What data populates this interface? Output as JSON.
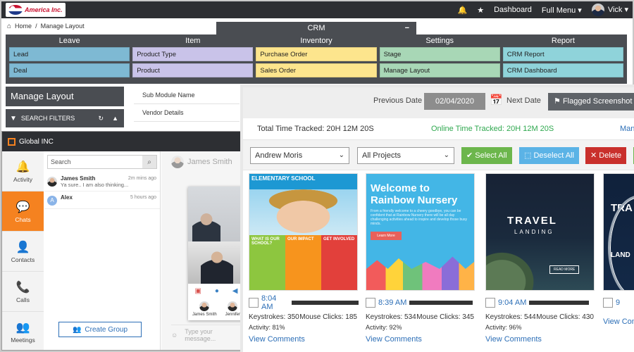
{
  "crm": {
    "brand_text": "America Inc.",
    "nav": {
      "dashboard": "Dashboard",
      "full_menu": "Full Menu",
      "user": "Vick"
    },
    "breadcrumb": {
      "home": "Home",
      "separator": "/",
      "current": "Manage Layout"
    },
    "pill_title": "CRM",
    "pill_toggle": "−",
    "columns": [
      {
        "head": "Leave",
        "items": [
          "Lead",
          "Deal"
        ]
      },
      {
        "head": "Item",
        "items": [
          "Product Type",
          "Product"
        ]
      },
      {
        "head": "Inventory",
        "items": [
          "Purchase Order",
          "Sales Order"
        ]
      },
      {
        "head": "Settings",
        "items": [
          "Stage",
          "Manage Layout"
        ]
      },
      {
        "head": "Report",
        "items": [
          "CRM Report",
          "CRM Dashboard"
        ]
      }
    ],
    "manage_title": "Manage Layout",
    "filter_label": "SEARCH FILTERS",
    "sub_table": {
      "header": "Sub Module Name",
      "rows": [
        "Vendor Details"
      ]
    },
    "colors": {
      "lead": "#7eb9d3",
      "item": "#c9c3e9",
      "inventory": "#fde58d",
      "settings": "#a8d7b6",
      "report": "#8fd3da"
    }
  },
  "chat": {
    "title": "Global INC",
    "sidebar": [
      {
        "label": "Activity",
        "icon": "bell-icon"
      },
      {
        "label": "Chats",
        "icon": "chat-icon",
        "active": true
      },
      {
        "label": "Contacts",
        "icon": "person-icon"
      },
      {
        "label": "Calls",
        "icon": "phone-icon"
      },
      {
        "label": "Meetings",
        "icon": "group-icon"
      }
    ],
    "search_placeholder": "Search",
    "conversations": [
      {
        "name": "James Smith",
        "message": "Ya sure.. I am also thinking...",
        "time": "2m mins ago"
      },
      {
        "name": "Alex",
        "avatar_letter": "A",
        "message": "",
        "time": "5 hours ago"
      }
    ],
    "create_group": "Create Group",
    "header_name": "James Smith",
    "video_people": [
      "James Smith",
      "Jennifer"
    ],
    "type_placeholder": "Type your message..."
  },
  "tracker": {
    "previous_date_label": "Previous Date",
    "date": "02/04/2020",
    "next_date_label": "Next Date",
    "flagged_label": "Flagged Screenshot",
    "total_time": "Total Time Tracked: 20H 12M 20S",
    "online_time": "Online Time Tracked: 20H 12M 20S",
    "manual_link": "Manual",
    "employee_select": "Andrew Moris",
    "project_select": "All Projects",
    "select_all": "Select All",
    "deselect_all": "Deselect All",
    "delete": "Delete",
    "cards": [
      {
        "time": "8:04 AM",
        "keystrokes": "Keystrokes: 350",
        "clicks": "Mouse Clicks: 185",
        "activity": "Activity: 81%",
        "view": "View Comments",
        "progress": 0.95,
        "thumb": {
          "header": "ELEMENTARY SCHOOL",
          "blocks": [
            "WHAT IS OUR SCHOOL?",
            "OUR IMPACT",
            "GET INVOLVED"
          ]
        }
      },
      {
        "time": "8:39 AM",
        "keystrokes": "Keystrokes: 534",
        "clicks": "Mouse Clicks: 345",
        "activity": "Activity: 92%",
        "view": "View Comments",
        "progress": 0.9,
        "thumb": {
          "title": "Welcome to Rainbow Nursery",
          "text": "From a friendly welcome to a cheery goodbye, you can be confident that at Rainbow Nursery there will be all day challenging activities ahead to inspire and develop those busy minds.",
          "button": "Learn More"
        }
      },
      {
        "time": "9:04 AM",
        "keystrokes": "Keystrokes: 544",
        "clicks": "Mouse Clicks: 430",
        "activity": "Activity: 96%",
        "view": "View Comments",
        "progress": 0.85,
        "thumb": {
          "title": "TRAVEL",
          "sub": "LANDING",
          "button": "READ MORE"
        }
      },
      {
        "time": "9",
        "keystrokes": "",
        "clicks": "",
        "activity": "",
        "view": "View Com",
        "progress": 0,
        "thumb": {
          "title": "TRA",
          "sub": "LAND"
        }
      }
    ]
  }
}
